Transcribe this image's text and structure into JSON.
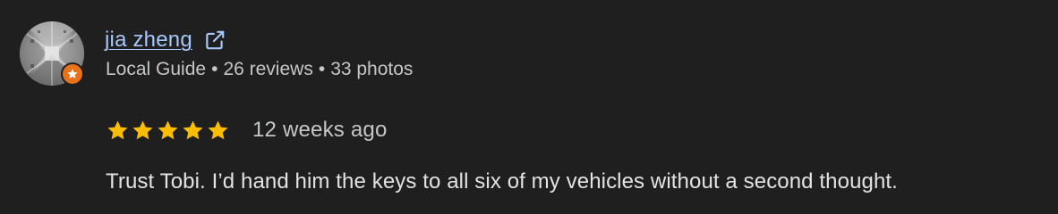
{
  "review": {
    "author": {
      "name": "jia zheng",
      "badge": "Local Guide",
      "reviews": "26 reviews",
      "photos": "33 photos",
      "separator": "•",
      "avatar_icon": "building-photo",
      "badge_icon": "local-guide-star-icon",
      "link_icon": "open-in-new-icon"
    },
    "rating": {
      "stars": 5,
      "max_stars": 5,
      "star_color": "#fbbc04",
      "time": "12 weeks ago"
    },
    "text": "Trust Tobi. I’d hand him the keys to all six of my vehicles without a second thought.",
    "colors": {
      "background": "#1f1f1f",
      "link": "#a8c7fa",
      "badge": "#e8711c",
      "meta_text": "#c4c7c5",
      "body_text": "#e3e3e3"
    }
  }
}
